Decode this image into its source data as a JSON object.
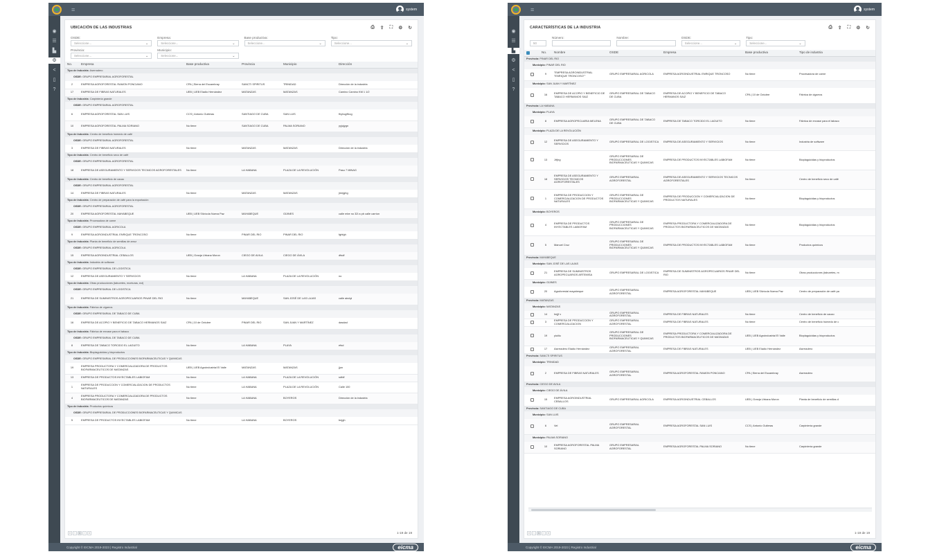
{
  "app": {
    "user": "system",
    "footer": "Copyright © EICMA 2019-2023 | Registro Industrial",
    "brand": "eicma"
  },
  "left": {
    "title": "UBICACIÓN DE LAS INDUSTRIAS",
    "filters": [
      {
        "label": "OSDE:",
        "placeholder": "Seleccione..."
      },
      {
        "label": "Empresa:",
        "placeholder": "Seleccione..."
      },
      {
        "label": "Base productiva:",
        "placeholder": "Seleccione..."
      },
      {
        "label": "Tipo:",
        "placeholder": "Seleccione..."
      },
      {
        "label": "Provincia:",
        "placeholder": "Seleccione..."
      },
      {
        "label": "Municipio:",
        "placeholder": "Seleccione..."
      }
    ],
    "columns": [
      "No.",
      "Empresa",
      "Base productiva",
      "Provincia",
      "Municipio",
      "Dirección"
    ],
    "rows": [
      {
        "k": "grp",
        "label": "Tipo de Industria:",
        "value": "Aserradero"
      },
      {
        "k": "sub",
        "label": "OSDE:",
        "value": "GRUPO EMPRESARIAL AGROFORESTAL"
      },
      {
        "k": "row",
        "c": [
          "2",
          "EMPRESA AGROFORESTAL RAMON PONCIANO",
          "CPA | Sierra del Escambray",
          "SANCTI SPIRITUS",
          "TRINIDAD",
          "Dirección de la industria"
        ]
      },
      {
        "k": "row",
        "c": [
          "17",
          "EMPRESA DE FIBRAS NATURALES",
          "UEB | UEB Eladio Hernández",
          "MATANZAS",
          "MATANZAS",
          "Camino Camino KM 1 1/2"
        ]
      },
      {
        "k": "grp",
        "label": "Tipo de Industria:",
        "value": "Carpintería grande"
      },
      {
        "k": "sub",
        "label": "OSDE:",
        "value": "GRUPO EMPRESARIAL AGROFORESTAL"
      },
      {
        "k": "row",
        "h": "tall",
        "c": [
          "6",
          "EMPRESA AGROFORESTAL SAN LUIS",
          "CCS | Antonio Guiteras",
          "SANTIAGO DE CUBA",
          "SAN LUIS",
          "fhyhcgffxcg"
        ]
      },
      {
        "k": "row",
        "h": "tall",
        "c": [
          "10",
          "EMPRESA AGROFORESTAL PALMA SORIANO",
          "No tiene",
          "SANTIAGO DE CUBA",
          "PALMA SORIANO",
          "yyjujygn"
        ]
      },
      {
        "k": "grp",
        "label": "Tipo de Industria:",
        "value": "Centro de beneficio húmedo de café"
      },
      {
        "k": "sub",
        "label": "OSDE:",
        "value": "GRUPO EMPRESARIAL AGROFORESTAL"
      },
      {
        "k": "row",
        "c": [
          "3",
          "EMPRESA DE FIBRAS NATURALES",
          "No tiene",
          "MATANZAS",
          "MATANZAS",
          "Dirección de la industria"
        ]
      },
      {
        "k": "grp",
        "label": "Tipo de Industria:",
        "value": "Centro de beneficio seco de café"
      },
      {
        "k": "sub",
        "label": "OSDE:",
        "value": "GRUPO EMPRESARIAL AGROFORESTAL"
      },
      {
        "k": "row",
        "h": "tall",
        "c": [
          "18",
          "EMPRESA DE ASEGURAMIENTO Y SERVICIOS TECNICOS AGROFORESTALES",
          "No tiene",
          "LA HABANA",
          "PLAZA DE LA REVOLUCIÓN",
          "Paso 7 MINAG"
        ]
      },
      {
        "k": "grp",
        "label": "Tipo de Industria:",
        "value": "Centro de beneficio de cacao"
      },
      {
        "k": "sub",
        "label": "OSDE:",
        "value": "GRUPO EMPRESARIAL AGROFORESTAL"
      },
      {
        "k": "row",
        "c": [
          "14",
          "EMPRESA DE FIBRAS NATURALES",
          "No tiene",
          "MATANZAS",
          "MATANZAS",
          "jmnjghg"
        ]
      },
      {
        "k": "grp",
        "label": "Tipo de Industria:",
        "value": "Centro de preparación de café para la exportación"
      },
      {
        "k": "sub",
        "label": "OSDE:",
        "value": "GRUPO EMPRESARIAL AGROFORESTAL"
      },
      {
        "k": "row",
        "c": [
          "20",
          "EMPRESA AGROFORESTAL MAYABEQUE",
          "UEB | UEB Silvícola Nueva Paz",
          "MAYABEQUE",
          "GÜINES",
          "calle mbe no 32l a pb calle carrion"
        ]
      },
      {
        "k": "grp",
        "label": "Tipo de Industria:",
        "value": "Procesadora de carne"
      },
      {
        "k": "sub",
        "label": "OSDE:",
        "value": "GRUPO EMPRESARIAL AGRICOLA"
      },
      {
        "k": "row",
        "c": [
          "9",
          "EMPRESA AGROINDUSTRIAL ENRIQUE TRONCOSO",
          "No tiene",
          "PINAR DEL RIO",
          "PINAR DEL RIO",
          "fghfgh"
        ]
      },
      {
        "k": "grp",
        "label": "Tipo de Industria:",
        "value": "Planta de beneficio de semillas de arroz"
      },
      {
        "k": "sub",
        "label": "OSDE:",
        "value": "GRUPO EMPRESARIAL AGRICOLA"
      },
      {
        "k": "row",
        "c": [
          "15",
          "EMPRESA AGROINDUSTRIAL CEBALLOS",
          "UEB | Granja Urbana Moron",
          "CIEGO DE AVILA",
          "CIEGO DE ÁVILA",
          "dfsdf"
        ]
      },
      {
        "k": "grp",
        "label": "Tipo de Industria:",
        "value": "Industria de software"
      },
      {
        "k": "sub",
        "label": "OSDE:",
        "value": "GRUPO EMPRESARIAL DE LOGISTICA"
      },
      {
        "k": "row",
        "c": [
          "12",
          "EMPRESA DE ASEGURAMIENTO Y SERVICIOS",
          "No tiene",
          "LA HABANA",
          "PLAZA DE LA REVOLUCIÓN",
          "no"
        ]
      },
      {
        "k": "grp",
        "label": "Tipo de Industria:",
        "value": "Otras producciones (taburetes, monturas, ect)"
      },
      {
        "k": "sub",
        "label": "OSDE:",
        "value": "GRUPO EMPRESARIAL DE LOGISTICA"
      },
      {
        "k": "row",
        "h": "tall",
        "c": [
          "21",
          "EMPRESA DE SUMINISTROS AGROPECUARIOS PINAR DEL RIO",
          "No tiene",
          "MAYABEQUE",
          "SAN JOSÉ DE LAS LAJAS",
          "calle aindyi"
        ]
      },
      {
        "k": "grp",
        "label": "Tipo de Industria:",
        "value": "Fábrica de cigarros"
      },
      {
        "k": "sub",
        "label": "OSDE:",
        "value": "GRUPO EMPRESARIAL DE TABACO DE CUBA"
      },
      {
        "k": "row",
        "h": "tall",
        "c": [
          "16",
          "EMPRESA DE ACOPIO Y BENEFICIO DE TABACO HERMANOS SAIZ",
          "CPA | 10 de Octubre",
          "PINAR DEL RIO",
          "SAN JUAN Y MARTÍNEZ",
          "dasdad"
        ]
      },
      {
        "k": "grp",
        "label": "Tipo de Industria:",
        "value": "Fábrica de envase para el tabaco"
      },
      {
        "k": "sub",
        "label": "OSDE:",
        "value": "GRUPO EMPRESARIAL DE TABACO DE CUBA"
      },
      {
        "k": "row",
        "c": [
          "8",
          "EMPRESA DE TABACO TORCIDO EL LAGUITO",
          "No tiene",
          "LA HABANA",
          "PLAYA",
          "efsd"
        ]
      },
      {
        "k": "grp",
        "label": "Tipo de Industria:",
        "value": "Bioplaguicidas y bioproductos"
      },
      {
        "k": "sub",
        "label": "OSDE:",
        "value": "GRUPO EMPRESARIAL DE PRODUCCIONES BIOFARMACEUTICAS Y QUIMICAS"
      },
      {
        "k": "row",
        "h": "tall",
        "c": [
          "19",
          "EMPRESA PRODUCTORA Y COMERCIALIZADORA DE PRODUCTOS BIOFARMACEUTICOS DE MATANZAS",
          "UEB | UEB Agroindustrial El Valle",
          "MATANZAS",
          "MATANZAS",
          "jjun"
        ]
      },
      {
        "k": "row",
        "c": [
          "13",
          "EMPRESA DE PRODUCTOS INYECTABLES LABIOFAM",
          "No tiene",
          "LA HABANA",
          "PLAZA DE LA REVOLUCIÓN",
          "sdfdf"
        ]
      },
      {
        "k": "row",
        "h": "tall",
        "c": [
          "1",
          "EMPRESA DE PRODUCCION Y COMERCIALIZACION DE PRODUCTOS NATURALES",
          "No tiene",
          "LA HABANA",
          "PLAZA DE LA REVOLUCIÓN",
          "Calle 100"
        ]
      },
      {
        "k": "row",
        "h": "tall",
        "c": [
          "4",
          "EMPRESA PRODUCTORA Y COMERCIALIZADORA DE PRODUCTOS BIOFARMACEUTICOS DE MATANZAS",
          "No tiene",
          "LA HABANA",
          "BOYEROS",
          "Dirección de la industria"
        ]
      },
      {
        "k": "grp",
        "label": "Tipo de Industria:",
        "value": "Productos químicos"
      },
      {
        "k": "sub",
        "label": "OSDE:",
        "value": "GRUPO EMPRESARIAL DE PRODUCCIONES BIOFARMACEUTICAS Y QUIMICAS"
      },
      {
        "k": "row",
        "c": [
          "5",
          "EMPRESA DE PRODUCTOS INYECTABLES LABIOFAM",
          "No tiene",
          "LA HABANA",
          "BOYEROS",
          "bnjgh"
        ]
      }
    ],
    "pager": {
      "page": "1",
      "info": "1-19 de 19"
    }
  },
  "right": {
    "title": "CARACTERÍSTICAS DE LA INDUSTRIA",
    "filters": [
      {
        "label": "",
        "placeholder": "50"
      },
      {
        "label": "Número:",
        "placeholder": ""
      },
      {
        "label": "Nombre:",
        "placeholder": ""
      },
      {
        "label": "OSDE:",
        "placeholder": "Seleccione..."
      },
      {
        "label": "Tipo:",
        "placeholder": "Seleccione..."
      }
    ],
    "columns": [
      "",
      "No.",
      "Nombre",
      "OSDE",
      "Empresa",
      "Base productiva",
      "Tipo de industria"
    ],
    "rows": [
      {
        "k": "grp",
        "label": "Provincia:",
        "value": "PINAR DEL RIO"
      },
      {
        "k": "sub",
        "label": "Municipio:",
        "value": "PINAR DEL RIO"
      },
      {
        "k": "row",
        "h": "tall",
        "c": [
          "9",
          "\"EMPRESA AGROINDUSTRIAL \"ENRIQUE TRONCOSO\"\"",
          "GRUPO EMPRESARIAL AGRICOLA",
          "EMPRESA AGROINDUSTRIAL ENRIQUE TRONCOSO",
          "No tiene",
          "Procesadora de carne"
        ]
      },
      {
        "k": "sub",
        "label": "Municipio:",
        "value": "SAN JUAN Y MARTÍNEZ"
      },
      {
        "k": "row",
        "h": "t3",
        "c": [
          "16",
          "EMPRESA DE ACOPIO Y BENEFICIO DE TABACO HERMANOS SAIZ",
          "GRUPO EMPRESARIAL DE TABACO DE CUBA",
          "EMPRESA DE ACOPIO Y BENEFICIO DE TABACO HERMANOS SAIZ",
          "CPA | 10 de Octubre",
          "Fábrica de cigarros"
        ]
      },
      {
        "k": "grp",
        "label": "Provincia:",
        "value": "LA HABANA"
      },
      {
        "k": "sub",
        "label": "Municipio:",
        "value": "PLAYA"
      },
      {
        "k": "row",
        "h": "tall",
        "c": [
          "8",
          "EMPRESA AGROPECUARIA MELENA",
          "GRUPO EMPRESARIAL DE TABACO DE CUBA",
          "EMPRESA DE TABACO TORCIDO EL LAGUITO",
          "No tiene",
          "Fábrica de envase para el tabaco"
        ]
      },
      {
        "k": "sub",
        "label": "Municipio:",
        "value": "PLAZA DE LA REVOLUCIÓN"
      },
      {
        "k": "row",
        "h": "t3",
        "c": [
          "12",
          "EMPRESA DE ASEGURAMIENTO Y SERVICIOS",
          "GRUPO EMPRESARIAL DE LOGISTICA",
          "EMPRESA DE ASEGURAMIENTO Y SERVICIOS",
          "No tiene",
          "Industria de software"
        ]
      },
      {
        "k": "row",
        "h": "t4",
        "c": [
          "13",
          "Jrfjng",
          "GRUPO EMPRESARIAL DE PRODUCCIONES BIOFARMACEUTICAS Y QUIMICAS",
          "EMPRESA DE PRODUCTOS INYECTABLES LABIOFAM",
          "No tiene",
          "Bioplaguicidas y bioproductos"
        ]
      },
      {
        "k": "row",
        "h": "t4",
        "c": [
          "18",
          "EMPRESA DE ASEGURAMIENTO Y SERVICIOS TECNICOS AGROFORESTALES",
          "GRUPO EMPRESARIAL AGROFORESTAL",
          "EMPRESA DE ASEGURAMIENTO Y SERVICIOS TECNICOS AGROFORESTALES",
          "No tiene",
          "Centro de beneficio seco de café"
        ]
      },
      {
        "k": "row",
        "h": "t4",
        "c": [
          "1",
          "EMPRESA DE PRODUCCION Y COMERCIALIZACION DE PRODUCTOS NATURALES",
          "GRUPO EMPRESARIAL DE PRODUCCIONES BIOFARMACEUTICAS Y QUIMICAS",
          "EMPRESA DE PRODUCCION Y COMERCIALIZACION DE PRODUCTOS NATURALES",
          "No tiene",
          "Bioplaguicidas y bioproductos"
        ]
      },
      {
        "k": "sub",
        "label": "Municipio:",
        "value": "BOYEROS"
      },
      {
        "k": "row",
        "h": "t4",
        "c": [
          "4",
          "EMPRESA DE PRODUCTOS INYECTABLES LABIOFAM",
          "GRUPO EMPRESARIAL DE PRODUCCIONES BIOFARMACEUTICAS Y QUIMICAS",
          "EMPRESA PRODUCTORA Y COMERCIALIZADORA DE PRODUCTOS BIOFARMACEUTICOS DE MATANZAS",
          "No tiene",
          "Bioplaguicidas y bioproductos"
        ]
      },
      {
        "k": "row",
        "h": "t4",
        "c": [
          "5",
          "Manuel Cruz",
          "GRUPO EMPRESARIAL DE PRODUCCIONES BIOFARMACEUTICAS Y QUIMICAS",
          "EMPRESA DE PRODUCTOS INYECTABLES LABIOFAM",
          "No tiene",
          "Productos químicos"
        ]
      },
      {
        "k": "grp",
        "label": "Provincia:",
        "value": "MAYABEQUE"
      },
      {
        "k": "sub",
        "label": "Municipio:",
        "value": "SAN JOSÉ DE LAS LAJAS"
      },
      {
        "k": "row",
        "h": "tall",
        "c": [
          "21",
          "EMPRESA DE SUMINISTROS AGROPECUARIOS ARTEMISA",
          "GRUPO EMPRESARIAL DE LOGISTICA",
          "EMPRESA DE SUMINISTROS AGROPECUARIOS PINAR DEL RIO",
          "No tiene",
          "Otras producciones (taburetes, m"
        ]
      },
      {
        "k": "sub",
        "label": "Municipio:",
        "value": "GÜINES"
      },
      {
        "k": "row",
        "h": "tall",
        "c": [
          "20",
          "Agroforestal mayabeque",
          "GRUPO EMPRESARIAL AGROFORESTAL",
          "EMPRESA AGROFORESTAL MAYABEQUE",
          "UEB | UEB Silvícola Nueva Paz",
          "Centro de preparación de café pa"
        ]
      },
      {
        "k": "grp",
        "label": "Provincia:",
        "value": "MATANZAS"
      },
      {
        "k": "sub",
        "label": "Municipio:",
        "value": "MATANZAS"
      },
      {
        "k": "row",
        "c": [
          "14",
          "hnjjf v",
          "GRUPO EMPRESARIAL AGROFORESTAL",
          "EMPRESA DE FIBRAS NATURALES",
          "No tiene",
          "Centro de beneficio de cacao"
        ]
      },
      {
        "k": "row",
        "c": [
          "3",
          "EMPRESA DE PRODUCCION Y COMERCIALIZACION",
          "GRUPO EMPRESARIAL AGROFORESTAL",
          "EMPRESA DE FIBRAS NATURALES",
          "No tiene",
          "Centro de beneficio húmedo de c"
        ]
      },
      {
        "k": "row",
        "h": "t4",
        "c": [
          "19",
          "yiuiiiu",
          "GRUPO EMPRESARIAL DE PRODUCCIONES BIOFARMACEUTICAS Y QUIMICAS",
          "EMPRESA PRODUCTORA Y COMERCIALIZADORA DE PRODUCTOS BIOFARMACEUTICOS DE MATANZAS",
          "UEB | UEB Agroindustrial El Valle",
          "Bioplaguicidas y bioproductos"
        ]
      },
      {
        "k": "row",
        "c": [
          "17",
          "Aserradero Eladio Hernández",
          "GRUPO EMPRESARIAL AGROFORESTAL",
          "EMPRESA DE FIBRAS NATURALES",
          "UEB | UEB Eladio Hernández",
          "Aserradero"
        ]
      },
      {
        "k": "grp",
        "label": "Provincia:",
        "value": "SANCTI SPIRITUS"
      },
      {
        "k": "sub",
        "label": "Municipio:",
        "value": "TRINIDAD"
      },
      {
        "k": "row",
        "h": "t3",
        "c": [
          "2",
          "EMPRESA DE FIBRAS NATURALES",
          "GRUPO EMPRESARIAL AGROFORESTAL",
          "EMPRESA AGROFORESTAL RAMON PONCIANO",
          "CPA | Sierra del Escambray",
          "Aserradero"
        ]
      },
      {
        "k": "grp",
        "label": "Provincia:",
        "value": "CIEGO DE AVILA"
      },
      {
        "k": "sub",
        "label": "Municipio:",
        "value": "CIEGO DE ÁVILA"
      },
      {
        "k": "row",
        "h": "tall",
        "c": [
          "15",
          "EMPRESA AGROINDUSTRIAL CEBALLOS",
          "GRUPO EMPRESARIAL AGRICOLA",
          "EMPRESA AGROINDUSTRIAL CEBALLOS",
          "UEB | Granja Urbana Moron",
          "Planta de beneficio de semillas d"
        ]
      },
      {
        "k": "grp",
        "label": "Provincia:",
        "value": "SANTIAGO DE CUBA"
      },
      {
        "k": "sub",
        "label": "Municipio:",
        "value": "SAN LUIS"
      },
      {
        "k": "row",
        "h": "t3",
        "c": [
          "6",
          "Vel",
          "GRUPO EMPRESARIAL AGROFORESTAL",
          "EMPRESA AGROFORESTAL SAN LUIS",
          "CCS | Antonio Guiteras",
          "Carpintería grande"
        ]
      },
      {
        "k": "sub",
        "label": "Municipio:",
        "value": "PALMA SORIANO"
      },
      {
        "k": "row",
        "h": "tall",
        "c": [
          "10",
          "EMPRESA AGROFORESTAL PALMA SORIANO",
          "GRUPO EMPRESARIAL AGROFORESTAL",
          "EMPRESA AGROFORESTAL PALMA SORIANO",
          "No tiene",
          "Carpintería grande"
        ]
      }
    ],
    "pager": {
      "page": "1",
      "info": "1-19 de 19"
    }
  }
}
